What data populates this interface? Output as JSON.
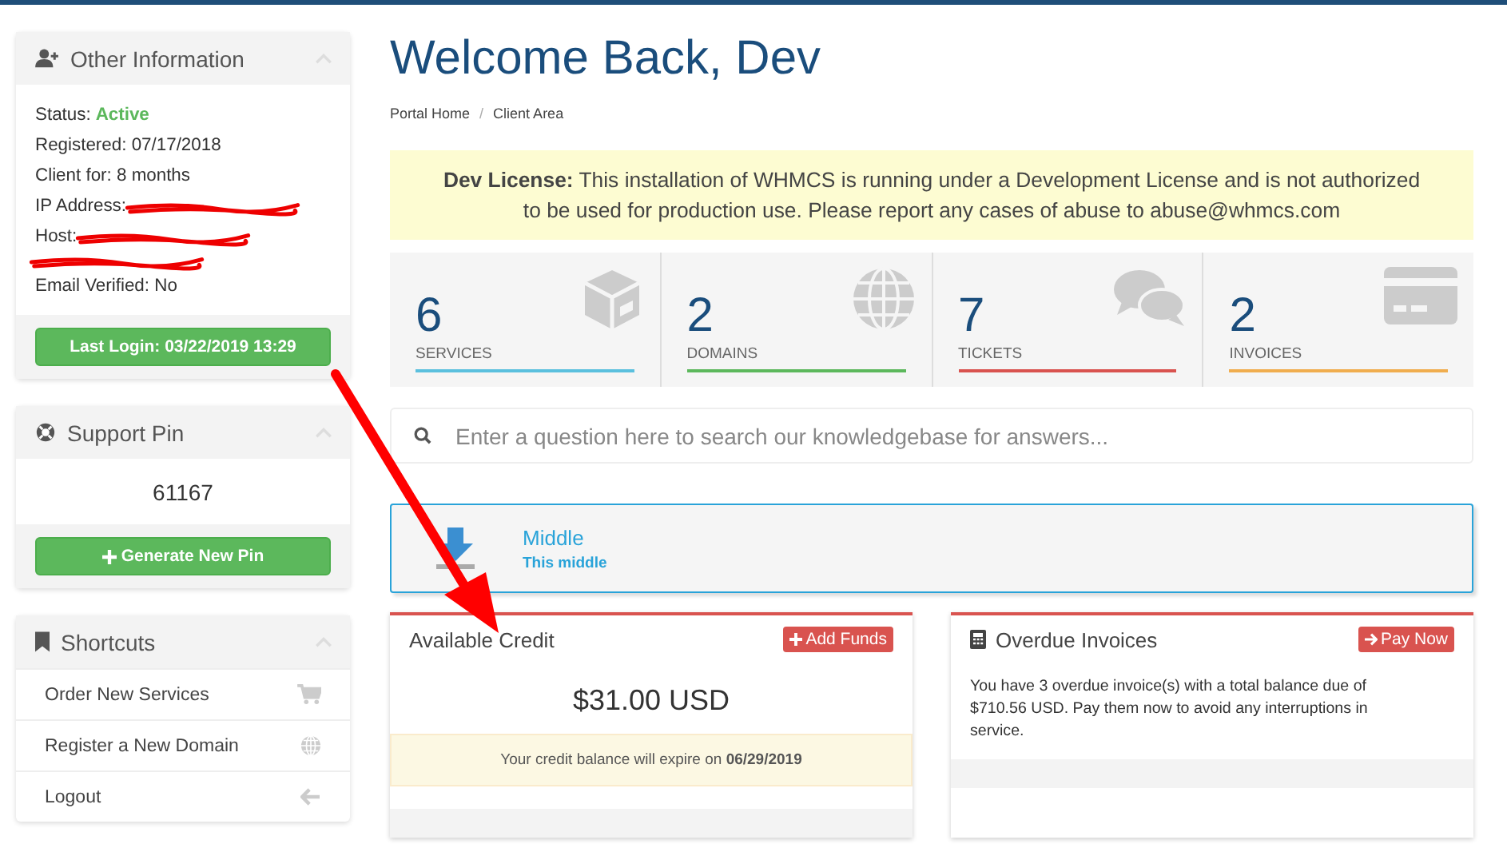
{
  "sidebar": {
    "other_information": {
      "title": "Other Information",
      "status_label": "Status:",
      "status_value": "Active",
      "lines": [
        "Registered: 07/17/2018",
        "Client for: 8 months"
      ],
      "redacted": [
        {
          "kind": "labelled",
          "label": "IP Address:"
        },
        {
          "kind": "labelled",
          "label": "Host:"
        },
        {
          "kind": "scribble"
        }
      ],
      "email_verified": "Email Verified: No",
      "button": "Last Login: 03/22/2019 13:29"
    },
    "support_pin": {
      "title": "Support Pin",
      "pin": "61167",
      "button": "Generate New Pin"
    },
    "shortcuts": {
      "title": "Shortcuts",
      "items": [
        {
          "label": "Order New Services"
        },
        {
          "label": "Register a New Domain"
        },
        {
          "label": "Logout"
        }
      ]
    }
  },
  "heading": "Welcome Back, Dev",
  "breadcrumb": [
    "Portal Home",
    "/",
    "Client Area"
  ],
  "alert": "**Dev License:** This installation of WHMCS is running under a Development License and is not authorized to be used for production use. Please report any cases of abuse to abuse@whmcs.com",
  "tiles": [
    {
      "count": "6",
      "label": "SERVICES",
      "color": "#5bc0de"
    },
    {
      "count": "2",
      "label": "DOMAINS",
      "color": "#5cb85c"
    },
    {
      "count": "7",
      "label": "TICKETS",
      "color": "#d9534f"
    },
    {
      "count": "2",
      "label": "INVOICES",
      "color": "#f0ad4e"
    }
  ],
  "search": {
    "placeholder": "Enter a question here to search our knowledgebase for answers..."
  },
  "promo": {
    "title": "Middle",
    "subtitle": "This middle"
  },
  "credit_panel": {
    "title": "Available Credit",
    "button": "Add Funds",
    "amount": "$31.00 USD",
    "note": "Your credit balance will expire on **06/29/2019**"
  },
  "overdue_panel": {
    "title": "Overdue Invoices",
    "button": "Pay Now",
    "text": "You have 3 overdue invoice(s) with a total balance due of $710.56 USD. Pay them now to avoid any interruptions in service."
  }
}
